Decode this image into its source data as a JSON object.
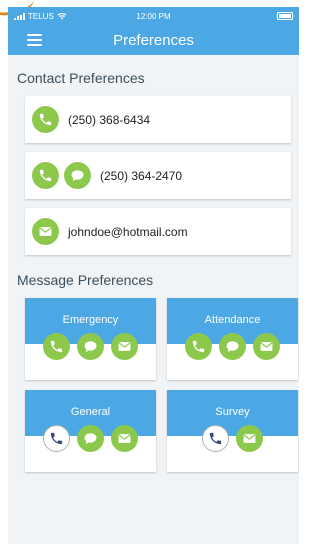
{
  "status_bar": {
    "carrier": "TELUS",
    "time": "12:00 PM"
  },
  "header": {
    "title": "Preferences"
  },
  "contact_section": {
    "title": "Contact Preferences",
    "items": [
      {
        "value": "(250) 368-6434",
        "icons": [
          "phone-icon"
        ]
      },
      {
        "value": "(250) 364-2470",
        "icons": [
          "phone-icon",
          "chat-bubble-icon"
        ]
      },
      {
        "value": "johndoe@hotmail.com",
        "icons": [
          "mail-icon"
        ]
      }
    ]
  },
  "message_section": {
    "title": "Message Preferences",
    "cards": [
      {
        "label": "Emergency",
        "phone_enabled": true,
        "icons": [
          "phone-icon",
          "chat-bubble-icon",
          "mail-icon"
        ]
      },
      {
        "label": "Attendance",
        "phone_enabled": true,
        "icons": [
          "phone-icon",
          "chat-bubble-icon",
          "mail-icon"
        ]
      },
      {
        "label": "General",
        "phone_enabled": false,
        "icons": [
          "phone-icon",
          "chat-bubble-icon",
          "mail-icon"
        ]
      },
      {
        "label": "Survey",
        "phone_enabled": false,
        "icons": [
          "phone-icon",
          "mail-icon"
        ]
      }
    ]
  },
  "colors": {
    "header_blue": "#4ba8e5",
    "icon_green": "#8cc84b",
    "background": "#f1f4f6"
  }
}
